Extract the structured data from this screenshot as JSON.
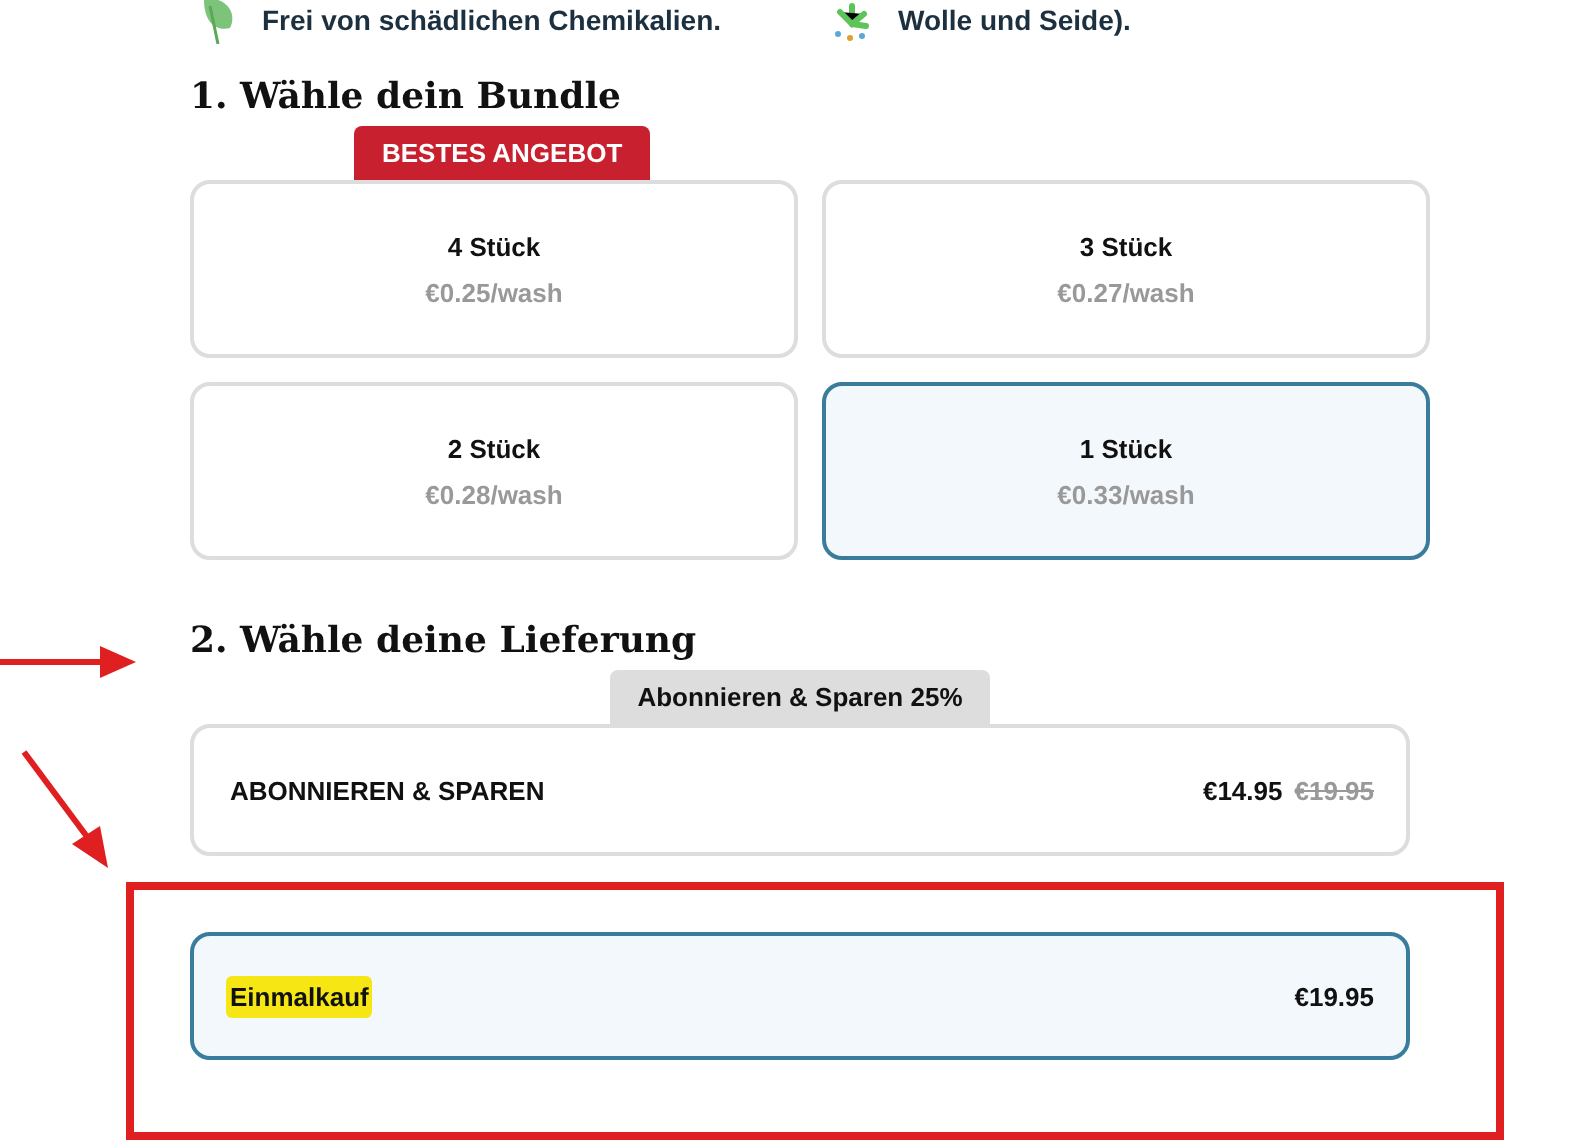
{
  "features": [
    {
      "kind": "leaf",
      "text": "Frei von schädlichen Chemikalien."
    },
    {
      "kind": "sparkle",
      "text": "Wolle und Seide)."
    }
  ],
  "bundle": {
    "title": "1. Wähle dein Bundle",
    "badge": "BESTES ANGEBOT",
    "options": [
      {
        "name": "4 Stück",
        "price": "€0.25/wash",
        "selected": false
      },
      {
        "name": "3 Stück",
        "price": "€0.27/wash",
        "selected": false
      },
      {
        "name": "2 Stück",
        "price": "€0.28/wash",
        "selected": false
      },
      {
        "name": "1 Stück",
        "price": "€0.33/wash",
        "selected": true
      }
    ]
  },
  "delivery": {
    "title": "2. Wähle deine Lieferung",
    "tab": "Abonnieren & Sparen 25%",
    "options": [
      {
        "kind": "subscribe",
        "label": "ABONNIEREN & SPAREN",
        "price": "€14.95",
        "old_price": "€19.95",
        "selected": false,
        "highlighted": false
      },
      {
        "kind": "once",
        "label": "Einmalkauf",
        "price": "€19.95",
        "selected": true,
        "highlighted": true
      }
    ]
  }
}
